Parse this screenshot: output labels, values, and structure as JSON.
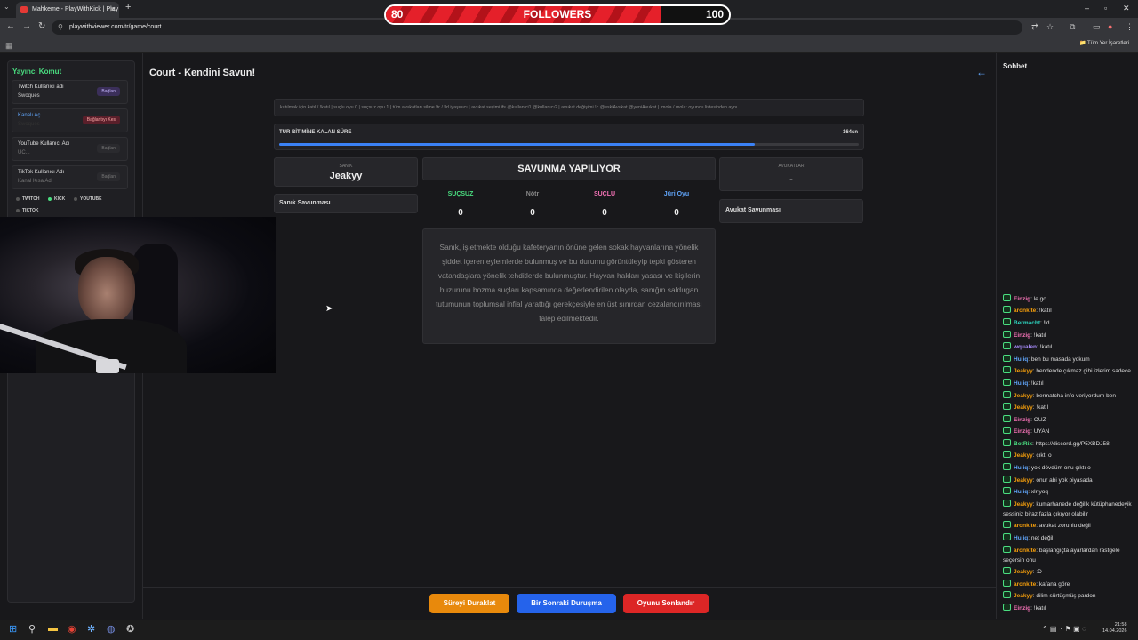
{
  "browser": {
    "tab_title": "Mahkeme - PlayWithKick | Play",
    "url": "playwithviewer.com/tr/game/court",
    "bookmarks_label": "Tüm Yer İşaretleri"
  },
  "overlay": {
    "label": "FOLLOWERS",
    "current": "80",
    "goal": "100",
    "progress": 0.8
  },
  "left_panel": {
    "title": "Yayıncı Komut",
    "twitch": {
      "label": "Twitch Kullanıcı adı",
      "value": "Swoques",
      "button": "Bağlan"
    },
    "kanal": {
      "label": "Kanalı Aç",
      "value": "Swoques",
      "button": "Bağlantıyı Kes"
    },
    "youtube": {
      "label": "YouTube Kullanıcı Adı",
      "value": "UC...",
      "button": "Bağlan"
    },
    "tiktok": {
      "label": "TikTok Kullanıcı Adı",
      "value": "Kanal Kısa Adı",
      "button": "Bağlan"
    },
    "platforms": [
      "TWITCH",
      "KICK",
      "YOUTUBE",
      "TIKTOK"
    ]
  },
  "main": {
    "title": "Court - Kendini Savun!",
    "commands": "katılmak için katıl / !katıl | suçlu oyu 0 | suçsuz oyu 1 | tüm avukatları silme !tr / !ld iyaşınıcı | avukat seçimi ifs @kullanici1 @kullanıcı2 | avukat değişimi !c @eskiAvukat @yeniAvukat | !mola / mola: oyuncu listesinden aynı",
    "timer_label": "TUR BİTİMİNE KALAN SÜRE",
    "timer_value": "164sn",
    "timer_progress": 0.82,
    "defendant_label": "SANIK",
    "defendant_name": "Jeakyy",
    "defendant_defense": "Sanık Savunması",
    "phase": "SAVUNMA YAPILIYOR",
    "lawyers_label": "AVUKATLAR",
    "lawyers_value": "-",
    "lawyer_defense": "Avukat Savunması",
    "votes": [
      {
        "label": "SUÇSUZ",
        "value": "0",
        "color": "#4ade80"
      },
      {
        "label": "Nötr",
        "value": "0",
        "color": "#888888"
      },
      {
        "label": "SUÇLU",
        "value": "0",
        "color": "#f472b6"
      },
      {
        "label": "Jüri Oyu",
        "value": "0",
        "color": "#60a5fa"
      }
    ],
    "accusation": "Sanık, işletmekte olduğu kafeteryanın önüne gelen sokak hayvanlarına yönelik şiddet içeren eylemlerde bulunmuş ve bu durumu görüntüleyip tepki gösteren vatandaşlara yönelik tehditlerde bulunmuştur. Hayvan hakları yasası ve kişilerin huzurunu bozma suçları kapsamında değerlendirilen olayda, sanığın saldırgan tutumunun toplumsal infial yarattığı gerekçesiyle en üst sınırdan cezalandırılması talep edilmektedir.",
    "buttons": {
      "pause": "Süreyi Duraklat",
      "next": "Bir Sonraki Duruşma",
      "end": "Oyunu Sonlandır"
    }
  },
  "chat": {
    "title": "Sohbet",
    "messages": [
      {
        "user": "Einzig",
        "text": "le go",
        "color": "#f472b6"
      },
      {
        "user": "aronkite",
        "text": "!katıl",
        "color": "#f59e0b"
      },
      {
        "user": "Bermacht",
        "text": "!ld",
        "color": "#2dd4bf"
      },
      {
        "user": "Einzig",
        "text": "!katıl",
        "color": "#f472b6"
      },
      {
        "user": "wqualen",
        "text": "!katıl",
        "color": "#a78bfa"
      },
      {
        "user": "Huliq",
        "text": "ben bu masada yokum",
        "color": "#60a5fa"
      },
      {
        "user": "Jeakyy",
        "text": "bendende çıkmaz gibi izlerim sadece",
        "color": "#f59e0b"
      },
      {
        "user": "Huliq",
        "text": "!katıl",
        "color": "#60a5fa"
      },
      {
        "user": "Jeakyy",
        "text": "bermatcha info veriyordum ben",
        "color": "#f59e0b"
      },
      {
        "user": "Jeakyy",
        "text": "!katıl",
        "color": "#f59e0b"
      },
      {
        "user": "Einzig",
        "text": "OUZ",
        "color": "#f472b6"
      },
      {
        "user": "Einzig",
        "text": "UYAN",
        "color": "#f472b6"
      },
      {
        "user": "BotRix",
        "text": "https://discord.gg/P5XBDJ58",
        "color": "#4ade80"
      },
      {
        "user": "Jeakyy",
        "text": "çıktı o",
        "color": "#f59e0b"
      },
      {
        "user": "Huliq",
        "text": "yok dövdüm onu çıktı o",
        "color": "#60a5fa"
      },
      {
        "user": "Jeakyy",
        "text": "onur abi yok piyasada",
        "color": "#f59e0b"
      },
      {
        "user": "Huliq",
        "text": "xlr yoq",
        "color": "#60a5fa"
      },
      {
        "user": "Jeakyy",
        "text": "kumarhanede değilik kütüphanedeyik sessiniz biraz fazla çıkıyor olabilir",
        "color": "#f59e0b"
      },
      {
        "user": "aronkite",
        "text": "avukat zorunlu değil",
        "color": "#f59e0b"
      },
      {
        "user": "Huliq",
        "text": "net değil",
        "color": "#60a5fa"
      },
      {
        "user": "aronkite",
        "text": "başlangıçta ayarlardan rastgele seçersin onu",
        "color": "#f59e0b"
      },
      {
        "user": "Jeakyy",
        "text": ":D",
        "color": "#f59e0b"
      },
      {
        "user": "aronkite",
        "text": "kafana göre",
        "color": "#f59e0b"
      },
      {
        "user": "Jeakyy",
        "text": "dilim sürtüşmüş pardon",
        "color": "#f59e0b"
      },
      {
        "user": "Einzig",
        "text": "!katıl",
        "color": "#f472b6"
      }
    ]
  },
  "taskbar": {
    "time": "21:58",
    "date": "14.04.2026"
  }
}
